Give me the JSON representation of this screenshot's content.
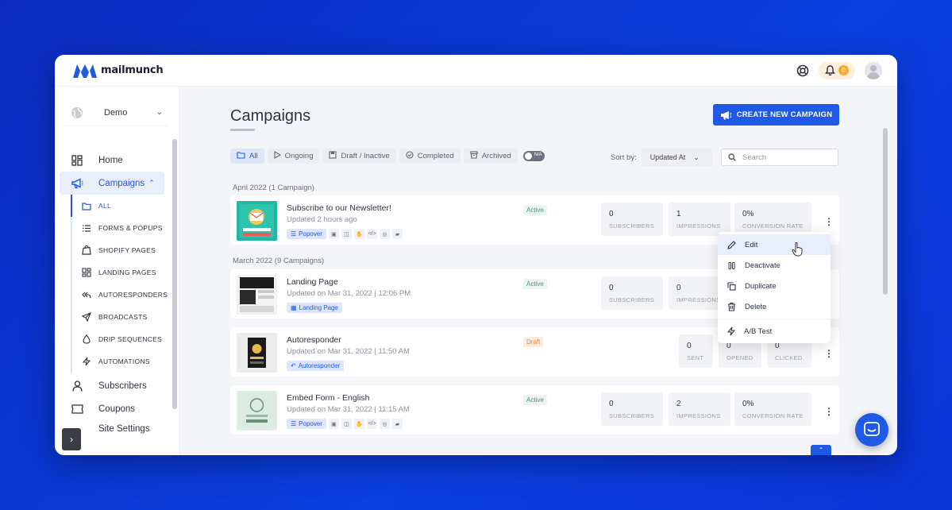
{
  "brand": {
    "name": "mailmunch",
    "accent": "#1f5ae6"
  },
  "header": {
    "notification_count": "0"
  },
  "sidebar": {
    "workspace": "Demo",
    "items": [
      {
        "label": "Home",
        "icon": "home-icon"
      },
      {
        "label": "Campaigns",
        "icon": "megaphone-icon"
      },
      {
        "label": "Subscribers",
        "icon": "user-icon"
      },
      {
        "label": "Coupons",
        "icon": "ticket-icon"
      },
      {
        "label": "Site Settings",
        "icon": "gear-icon"
      }
    ],
    "sub_items": [
      {
        "label": "ALL",
        "icon": "folder-icon"
      },
      {
        "label": "FORMS & POPUPS",
        "icon": "list-icon"
      },
      {
        "label": "SHOPIFY PAGES",
        "icon": "shopify-icon"
      },
      {
        "label": "LANDING PAGES",
        "icon": "layout-icon"
      },
      {
        "label": "AUTORESPONDERS",
        "icon": "reply-icon"
      },
      {
        "label": "BROADCASTS",
        "icon": "send-icon"
      },
      {
        "label": "DRIP SEQUENCES",
        "icon": "drop-icon"
      },
      {
        "label": "AUTOMATIONS",
        "icon": "bolt-icon"
      }
    ]
  },
  "main": {
    "title": "Campaigns",
    "create_label": "CREATE NEW CAMPAIGN",
    "filters": [
      "All",
      "Ongoing",
      "Draft / Inactive",
      "Completed",
      "Archived"
    ],
    "toggle_label": "N/A",
    "sort_label": "Sort by:",
    "sort_value": "Updated At",
    "search_placeholder": "Search",
    "groups": [
      "April 2022 (1 Campaign)",
      "March 2022 (9 Campaigns)"
    ],
    "campaigns": [
      {
        "title": "Subscribe to our Newsletter!",
        "updated": "Updated 2 hours ago",
        "tag": "Popover",
        "status": "Active",
        "stats": [
          {
            "value": "0",
            "label": "SUBSCRIBERS"
          },
          {
            "value": "1",
            "label": "IMPRESSIONS"
          },
          {
            "value": "0%",
            "label": "CONVERSION RATE"
          }
        ]
      },
      {
        "title": "Landing Page",
        "updated": "Updated on Mar 31, 2022 | 12:06 PM",
        "tag": "Landing Page",
        "status": "Active",
        "stats": [
          {
            "value": "0",
            "label": "SUBSCRIBERS"
          },
          {
            "value": "0",
            "label": "IMPRESSIONS"
          }
        ]
      },
      {
        "title": "Autoresponder",
        "updated": "Updated on Mar 31, 2022 | 11:50 AM",
        "tag": "Autoresponder",
        "status": "Draft",
        "stats": [
          {
            "value": "0",
            "label": "SENT"
          },
          {
            "value": "0",
            "label": "OPENED"
          },
          {
            "value": "0",
            "label": "CLICKED"
          }
        ]
      },
      {
        "title": "Embed Form - English",
        "updated": "Updated on Mar 31, 2022 | 11:15 AM",
        "tag": "Popover",
        "status": "Active",
        "stats": [
          {
            "value": "0",
            "label": "SUBSCRIBERS"
          },
          {
            "value": "2",
            "label": "IMPRESSIONS"
          },
          {
            "value": "0%",
            "label": "CONVERSION RATE"
          }
        ]
      }
    ]
  },
  "menu": {
    "items": [
      "Edit",
      "Deactivate",
      "Duplicate",
      "Delete",
      "A/B Test"
    ]
  }
}
